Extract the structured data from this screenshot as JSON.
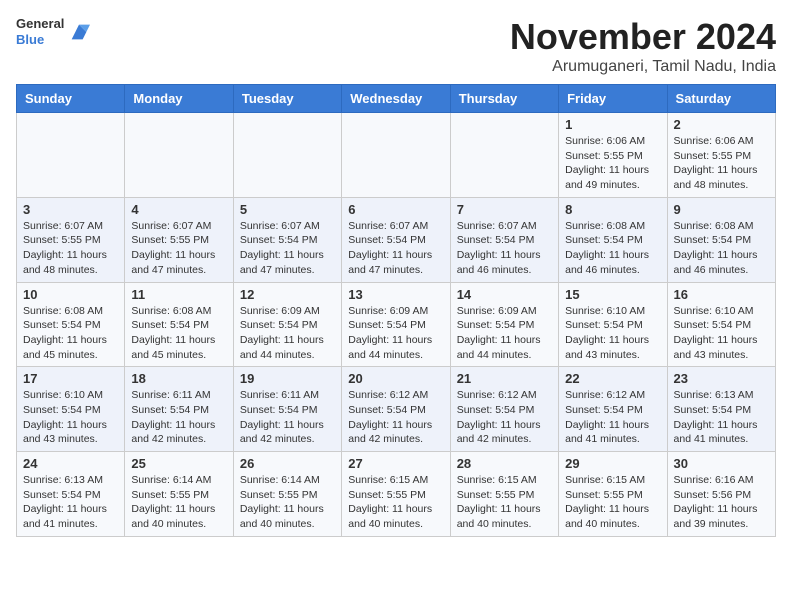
{
  "header": {
    "logo_line1": "General",
    "logo_line2": "Blue",
    "title": "November 2024",
    "subtitle": "Arumuganeri, Tamil Nadu, India"
  },
  "weekdays": [
    "Sunday",
    "Monday",
    "Tuesday",
    "Wednesday",
    "Thursday",
    "Friday",
    "Saturday"
  ],
  "weeks": [
    [
      {
        "date": "",
        "info": ""
      },
      {
        "date": "",
        "info": ""
      },
      {
        "date": "",
        "info": ""
      },
      {
        "date": "",
        "info": ""
      },
      {
        "date": "",
        "info": ""
      },
      {
        "date": "1",
        "info": "Sunrise: 6:06 AM\nSunset: 5:55 PM\nDaylight: 11 hours\nand 49 minutes."
      },
      {
        "date": "2",
        "info": "Sunrise: 6:06 AM\nSunset: 5:55 PM\nDaylight: 11 hours\nand 48 minutes."
      }
    ],
    [
      {
        "date": "3",
        "info": "Sunrise: 6:07 AM\nSunset: 5:55 PM\nDaylight: 11 hours\nand 48 minutes."
      },
      {
        "date": "4",
        "info": "Sunrise: 6:07 AM\nSunset: 5:55 PM\nDaylight: 11 hours\nand 47 minutes."
      },
      {
        "date": "5",
        "info": "Sunrise: 6:07 AM\nSunset: 5:54 PM\nDaylight: 11 hours\nand 47 minutes."
      },
      {
        "date": "6",
        "info": "Sunrise: 6:07 AM\nSunset: 5:54 PM\nDaylight: 11 hours\nand 47 minutes."
      },
      {
        "date": "7",
        "info": "Sunrise: 6:07 AM\nSunset: 5:54 PM\nDaylight: 11 hours\nand 46 minutes."
      },
      {
        "date": "8",
        "info": "Sunrise: 6:08 AM\nSunset: 5:54 PM\nDaylight: 11 hours\nand 46 minutes."
      },
      {
        "date": "9",
        "info": "Sunrise: 6:08 AM\nSunset: 5:54 PM\nDaylight: 11 hours\nand 46 minutes."
      }
    ],
    [
      {
        "date": "10",
        "info": "Sunrise: 6:08 AM\nSunset: 5:54 PM\nDaylight: 11 hours\nand 45 minutes."
      },
      {
        "date": "11",
        "info": "Sunrise: 6:08 AM\nSunset: 5:54 PM\nDaylight: 11 hours\nand 45 minutes."
      },
      {
        "date": "12",
        "info": "Sunrise: 6:09 AM\nSunset: 5:54 PM\nDaylight: 11 hours\nand 44 minutes."
      },
      {
        "date": "13",
        "info": "Sunrise: 6:09 AM\nSunset: 5:54 PM\nDaylight: 11 hours\nand 44 minutes."
      },
      {
        "date": "14",
        "info": "Sunrise: 6:09 AM\nSunset: 5:54 PM\nDaylight: 11 hours\nand 44 minutes."
      },
      {
        "date": "15",
        "info": "Sunrise: 6:10 AM\nSunset: 5:54 PM\nDaylight: 11 hours\nand 43 minutes."
      },
      {
        "date": "16",
        "info": "Sunrise: 6:10 AM\nSunset: 5:54 PM\nDaylight: 11 hours\nand 43 minutes."
      }
    ],
    [
      {
        "date": "17",
        "info": "Sunrise: 6:10 AM\nSunset: 5:54 PM\nDaylight: 11 hours\nand 43 minutes."
      },
      {
        "date": "18",
        "info": "Sunrise: 6:11 AM\nSunset: 5:54 PM\nDaylight: 11 hours\nand 42 minutes."
      },
      {
        "date": "19",
        "info": "Sunrise: 6:11 AM\nSunset: 5:54 PM\nDaylight: 11 hours\nand 42 minutes."
      },
      {
        "date": "20",
        "info": "Sunrise: 6:12 AM\nSunset: 5:54 PM\nDaylight: 11 hours\nand 42 minutes."
      },
      {
        "date": "21",
        "info": "Sunrise: 6:12 AM\nSunset: 5:54 PM\nDaylight: 11 hours\nand 42 minutes."
      },
      {
        "date": "22",
        "info": "Sunrise: 6:12 AM\nSunset: 5:54 PM\nDaylight: 11 hours\nand 41 minutes."
      },
      {
        "date": "23",
        "info": "Sunrise: 6:13 AM\nSunset: 5:54 PM\nDaylight: 11 hours\nand 41 minutes."
      }
    ],
    [
      {
        "date": "24",
        "info": "Sunrise: 6:13 AM\nSunset: 5:54 PM\nDaylight: 11 hours\nand 41 minutes."
      },
      {
        "date": "25",
        "info": "Sunrise: 6:14 AM\nSunset: 5:55 PM\nDaylight: 11 hours\nand 40 minutes."
      },
      {
        "date": "26",
        "info": "Sunrise: 6:14 AM\nSunset: 5:55 PM\nDaylight: 11 hours\nand 40 minutes."
      },
      {
        "date": "27",
        "info": "Sunrise: 6:15 AM\nSunset: 5:55 PM\nDaylight: 11 hours\nand 40 minutes."
      },
      {
        "date": "28",
        "info": "Sunrise: 6:15 AM\nSunset: 5:55 PM\nDaylight: 11 hours\nand 40 minutes."
      },
      {
        "date": "29",
        "info": "Sunrise: 6:15 AM\nSunset: 5:55 PM\nDaylight: 11 hours\nand 40 minutes."
      },
      {
        "date": "30",
        "info": "Sunrise: 6:16 AM\nSunset: 5:56 PM\nDaylight: 11 hours\nand 39 minutes."
      }
    ]
  ]
}
